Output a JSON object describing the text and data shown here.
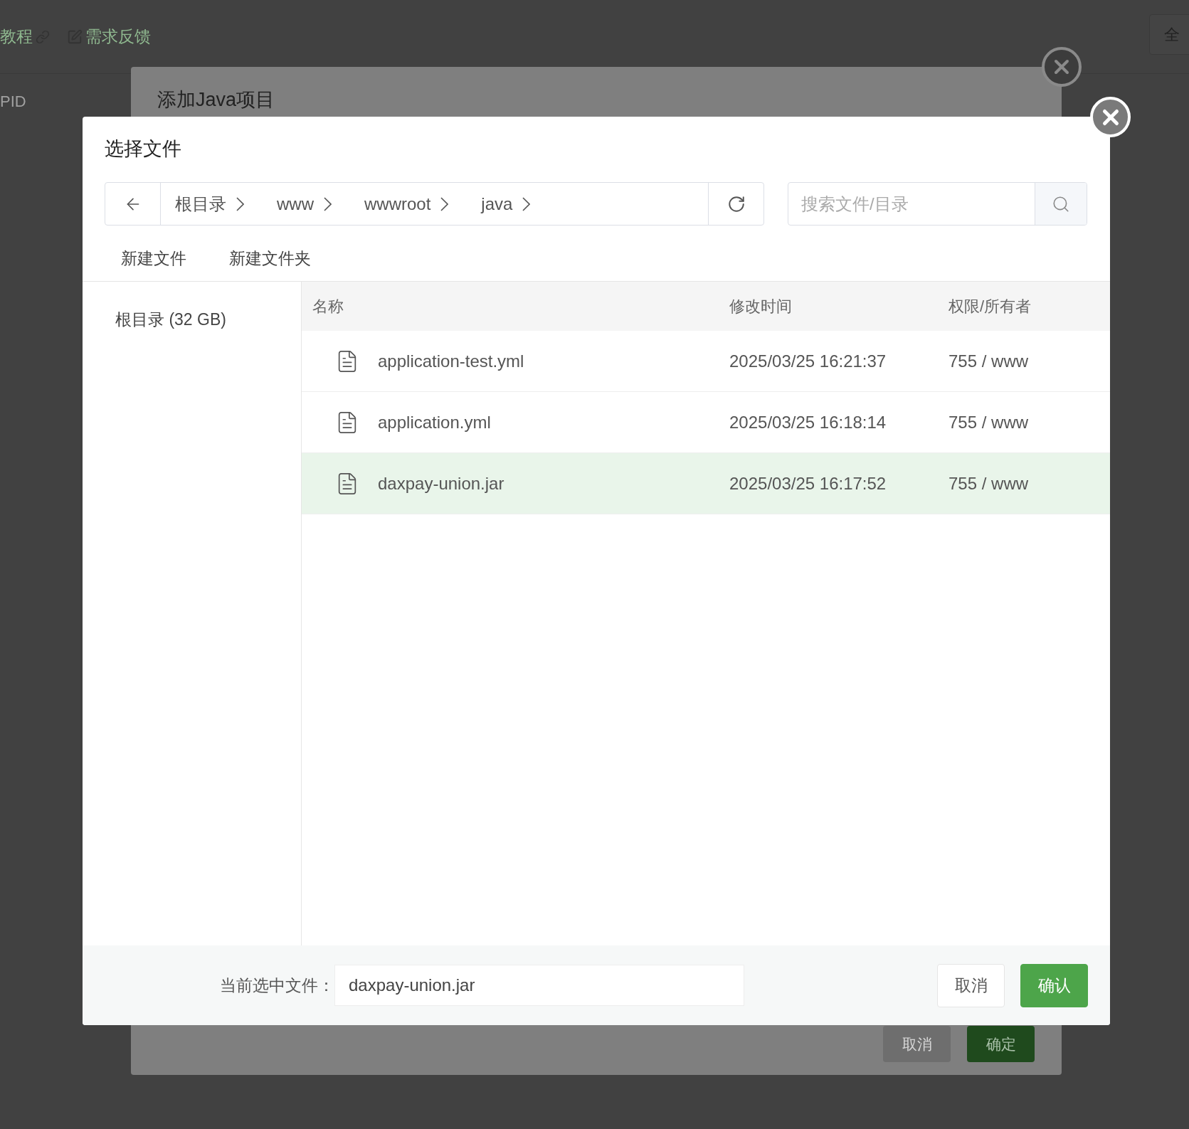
{
  "background_page": {
    "links": [
      {
        "label": "教程",
        "kind": "link"
      },
      {
        "label": "需求反馈",
        "kind": "feedback"
      }
    ],
    "column_header": "PID",
    "filter_button": "全"
  },
  "back_dialog": {
    "title": "添加Java项目",
    "buttons": [
      {
        "label": "取消",
        "primary": false
      },
      {
        "label": "确定",
        "primary": true
      }
    ]
  },
  "file_dialog": {
    "title": "选择文件",
    "breadcrumb": [
      "根目录",
      "www",
      "wwwroot",
      "java"
    ],
    "search": {
      "placeholder": "搜索文件/目录"
    },
    "actions": [
      "新建文件",
      "新建文件夹"
    ],
    "sidebar": [
      {
        "label": "根目录 (32 GB)"
      }
    ],
    "table": {
      "columns": [
        "名称",
        "修改时间",
        "权限/所有者"
      ],
      "rows": [
        {
          "name": "application-test.yml",
          "modified": "2025/03/25 16:21:37",
          "permission": "755 / www",
          "selected": false
        },
        {
          "name": "application.yml",
          "modified": "2025/03/25 16:18:14",
          "permission": "755 / www",
          "selected": false
        },
        {
          "name": "daxpay-union.jar",
          "modified": "2025/03/25 16:17:52",
          "permission": "755 / www",
          "selected": true
        }
      ]
    },
    "footer": {
      "label": "当前选中文件：",
      "value": "daxpay-union.jar",
      "buttons": [
        {
          "label": "取消",
          "primary": false
        },
        {
          "label": "确认",
          "primary": true
        }
      ]
    }
  }
}
